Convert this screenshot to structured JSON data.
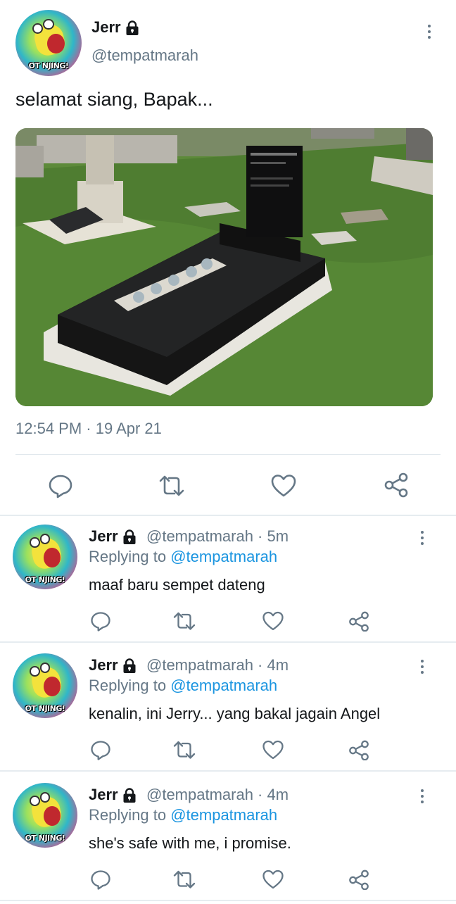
{
  "main_tweet": {
    "avatar_caption": "OT NJING!",
    "display_name": "Jerr",
    "handle": "@tempatmarah",
    "text": "selamat siang, Bapak...",
    "timestamp": "12:54 PM · 19 Apr 21",
    "photo": "black granite grave in a cemetery lawn",
    "actions": [
      "reply-icon",
      "retweet-icon",
      "like-icon",
      "share-icon"
    ]
  },
  "replies": [
    {
      "avatar_caption": "OT NJING!",
      "display_name": "Jerr",
      "handle_time": "@tempatmarah · 5m",
      "replying_prefix": "Replying to",
      "replying_to": "@tempatmarah",
      "text": "maaf baru sempet dateng"
    },
    {
      "avatar_caption": "OT NJING!",
      "display_name": "Jerr",
      "handle_time": "@tempatmarah · 4m",
      "replying_prefix": "Replying to",
      "replying_to": "@tempatmarah",
      "text": "kenalin, ini Jerry... yang bakal jagain Angel"
    },
    {
      "avatar_caption": "OT NJING!",
      "display_name": "Jerr",
      "handle_time": "@tempatmarah · 4m",
      "replying_prefix": "Replying to",
      "replying_to": "@tempatmarah",
      "text": "she's safe with me, i promise."
    }
  ],
  "colors": {
    "text": "#14171a",
    "secondary": "#657786",
    "mention": "#1b95e0",
    "divider": "#e6ecf0"
  }
}
